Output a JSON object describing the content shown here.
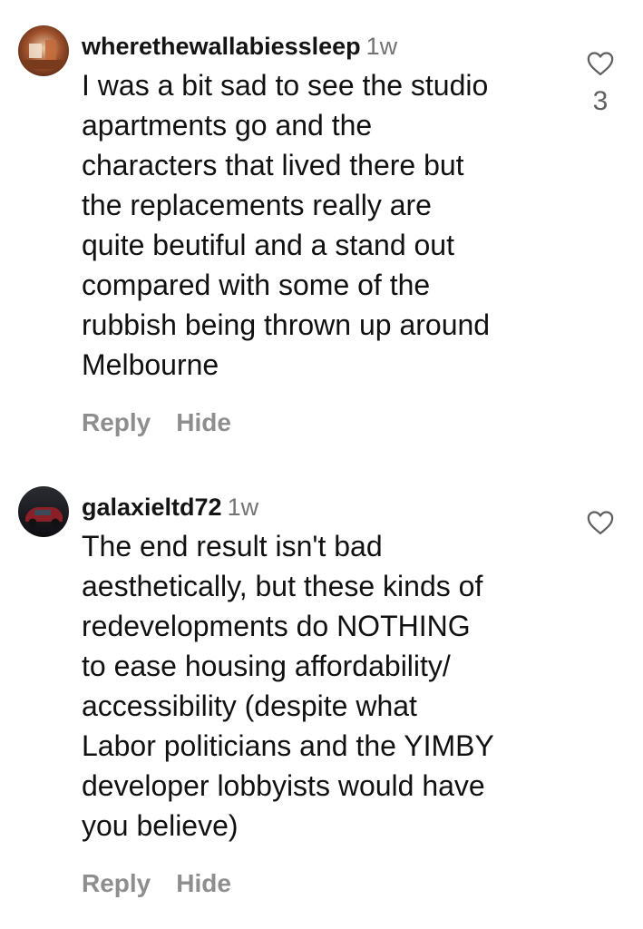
{
  "comments": [
    {
      "username": "wherethewallabiessleep",
      "time": "1w",
      "lines": [
        "I was a bit sad to see the studio",
        "apartments go and the",
        "characters that lived there but",
        "the replacements really are",
        "quite beutiful and a stand out",
        "compared with some of the",
        "rubbish being thrown up around",
        "Melbourne"
      ],
      "reply_label": "Reply",
      "hide_label": "Hide",
      "like_icon": "heart-outline-icon",
      "like_count": "3"
    },
    {
      "username": "galaxieltd72",
      "time": "1w",
      "lines": [
        "The end result isn't bad",
        "aesthetically, but these kinds of",
        "redevelopments do NOTHING",
        "to ease housing affordability/",
        "accessibility (despite what",
        "Labor politicians and the YIMBY",
        "developer lobbyists would have",
        "you believe)"
      ],
      "reply_label": "Reply",
      "hide_label": "Hide",
      "like_icon": "heart-outline-icon"
    }
  ]
}
